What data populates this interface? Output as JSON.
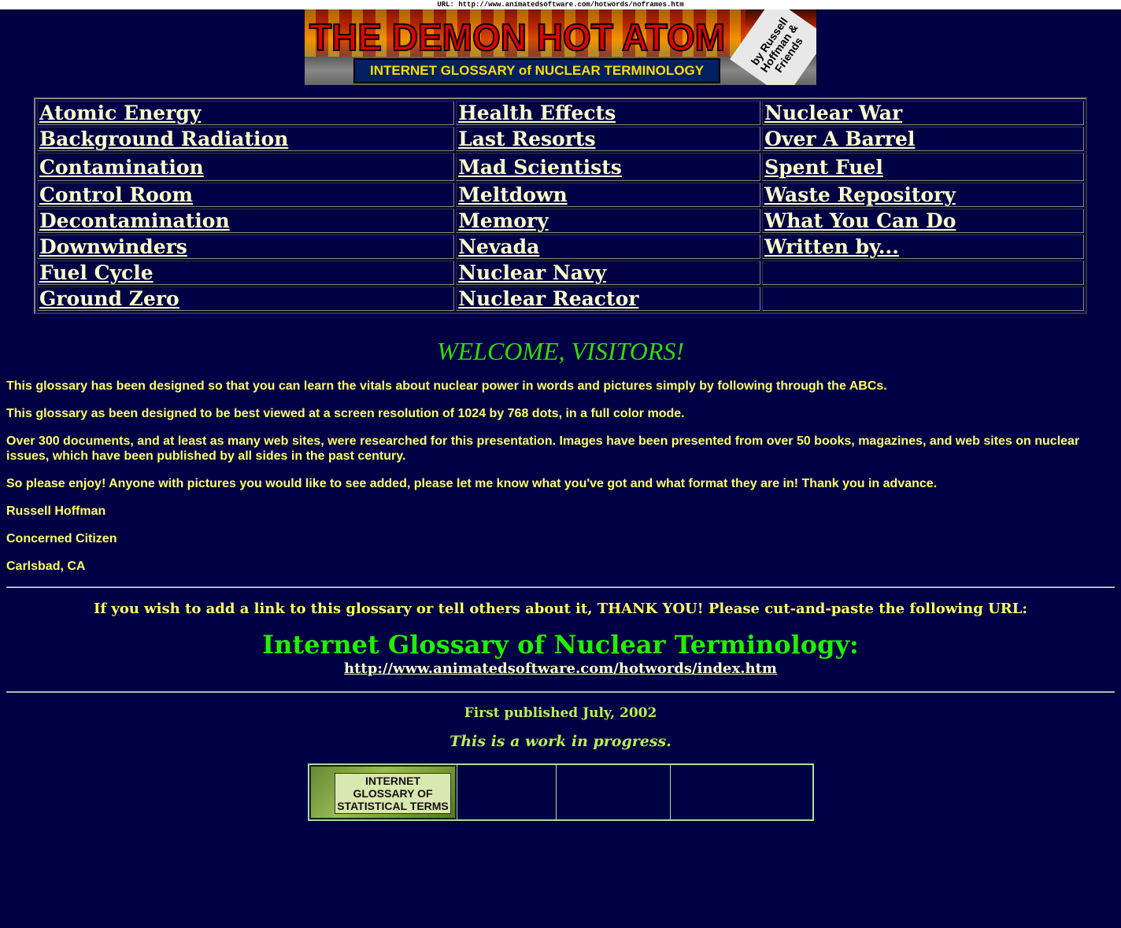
{
  "url_bar": "URL: http://www.animatedsoftware.com/hotwords/noframes.htm",
  "banner": {
    "title": "THE DEMON HOT ATOM",
    "subtitle": "INTERNET GLOSSARY of NUCLEAR TERMINOLOGY",
    "byline": "by Russell Hoffman & Friends"
  },
  "nav": {
    "col1": [
      "Atomic Energy",
      "Background Radiation",
      "Contamination",
      "Control Room",
      "Decontamination",
      "Downwinders",
      "Fuel Cycle",
      "Ground Zero"
    ],
    "col2": [
      "Health Effects",
      "Last Resorts",
      "Mad Scientists",
      "Meltdown",
      "Memory",
      "Nevada",
      "Nuclear Navy",
      "Nuclear Reactor"
    ],
    "col3": [
      "Nuclear War",
      "Over A Barrel",
      "Spent Fuel",
      "Waste Repository",
      "What You Can Do",
      "Written by...",
      "",
      ""
    ]
  },
  "welcome": "WELCOME, VISITORS!",
  "paragraphs": {
    "p1": "This glossary has been designed so that you can learn the vitals about nuclear power in words and pictures simply by following through the ABCs.",
    "p2": "This glossary as been designed to be best viewed at a screen resolution of 1024 by 768 dots, in a full color mode.",
    "p3": "Over 300 documents, and at least as many web sites, were researched for this presentation. Images have been presented from over 50 books, magazines, and web sites on nuclear issues, which have been published by all sides in the past century.",
    "p4": "So please enjoy! Anyone with pictures you would like to see added, please let me know what you've got and what format they are in! Thank you in advance.",
    "p5": "Russell Hoffman",
    "p6": "Concerned Citizen",
    "p7": "Carlsbad, CA"
  },
  "link_request": "If you wish to add a link to this glossary or tell others about it, THANK YOU! Please cut-and-paste the following URL:",
  "glossary_title": "Internet Glossary of Nuclear Terminology:",
  "glossary_url": "http://www.animatedsoftware.com/hotwords/index.htm",
  "published": "First published July, 2002",
  "progress": "This is a work in progress.",
  "stat_badge": {
    "line1": "INTERNET",
    "line2": "GLOSSARY OF",
    "line3": "STATISTICAL TERMS"
  }
}
